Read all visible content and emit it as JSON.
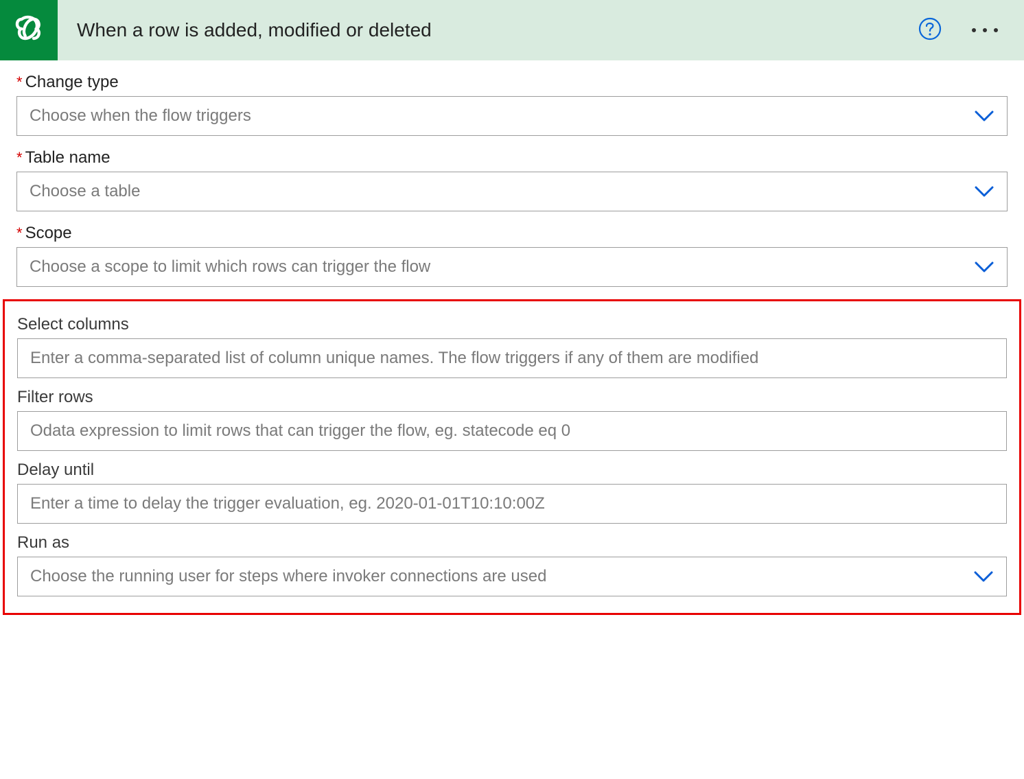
{
  "header": {
    "title": "When a row is added, modified or deleted"
  },
  "fields": {
    "change_type": {
      "label": "Change type",
      "placeholder": "Choose when the flow triggers",
      "required": true
    },
    "table_name": {
      "label": "Table name",
      "placeholder": "Choose a table",
      "required": true
    },
    "scope": {
      "label": "Scope",
      "placeholder": "Choose a scope to limit which rows can trigger the flow",
      "required": true
    },
    "select_columns": {
      "label": "Select columns",
      "placeholder": "Enter a comma-separated list of column unique names. The flow triggers if any of them are modified",
      "required": false
    },
    "filter_rows": {
      "label": "Filter rows",
      "placeholder": "Odata expression to limit rows that can trigger the flow, eg. statecode eq 0",
      "required": false
    },
    "delay_until": {
      "label": "Delay until",
      "placeholder": "Enter a time to delay the trigger evaluation, eg. 2020-01-01T10:10:00Z",
      "required": false
    },
    "run_as": {
      "label": "Run as",
      "placeholder": "Choose the running user for steps where invoker connections are used",
      "required": false
    }
  }
}
